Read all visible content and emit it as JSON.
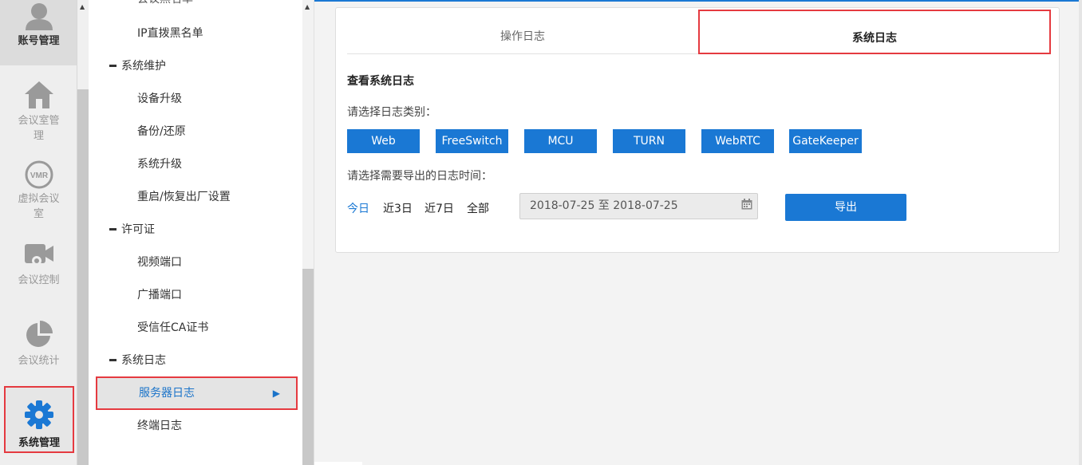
{
  "iconnav": {
    "items": [
      {
        "label": "账号管理",
        "icon": "user-icon"
      },
      {
        "label": "会议室管理",
        "icon": "home-icon"
      },
      {
        "label": "虚拟会议室",
        "icon": "vmr-icon",
        "badge": "VMR"
      },
      {
        "label": "会议控制",
        "icon": "video-gear-icon"
      },
      {
        "label": "会议统计",
        "icon": "pie-chart-icon"
      },
      {
        "label": "系统管理",
        "icon": "gear-icon"
      }
    ]
  },
  "tree": {
    "cut_item": "会议黑名单",
    "items": [
      {
        "label": "IP直拨黑名单",
        "kind": "child"
      },
      {
        "label": "系统维护",
        "kind": "group"
      },
      {
        "label": "设备升级",
        "kind": "child"
      },
      {
        "label": "备份/还原",
        "kind": "child"
      },
      {
        "label": "系统升级",
        "kind": "child"
      },
      {
        "label": "重启/恢复出厂设置",
        "kind": "child"
      },
      {
        "label": "许可证",
        "kind": "group"
      },
      {
        "label": "视频端口",
        "kind": "child"
      },
      {
        "label": "广播端口",
        "kind": "child"
      },
      {
        "label": "受信任CA证书",
        "kind": "child"
      },
      {
        "label": "系统日志",
        "kind": "group"
      },
      {
        "label": "服务器日志",
        "kind": "active"
      },
      {
        "label": "终端日志",
        "kind": "child"
      }
    ]
  },
  "tabs": {
    "ops": "操作日志",
    "sys": "系统日志"
  },
  "panel": {
    "title": "查看系统日志",
    "type_label": "请选择日志类别：",
    "types": [
      "Web",
      "FreeSwitch",
      "MCU",
      "TURN",
      "WebRTC",
      "GateKeeper"
    ],
    "time_label": "请选择需要导出的日志时间：",
    "ranges": [
      "今日",
      "近3日",
      "近7日",
      "全部"
    ],
    "date_value": "2018-07-25 至 2018-07-25",
    "export_label": "导出"
  },
  "colors": {
    "accent": "#1a78d4",
    "highlight_border": "#e53a40"
  }
}
